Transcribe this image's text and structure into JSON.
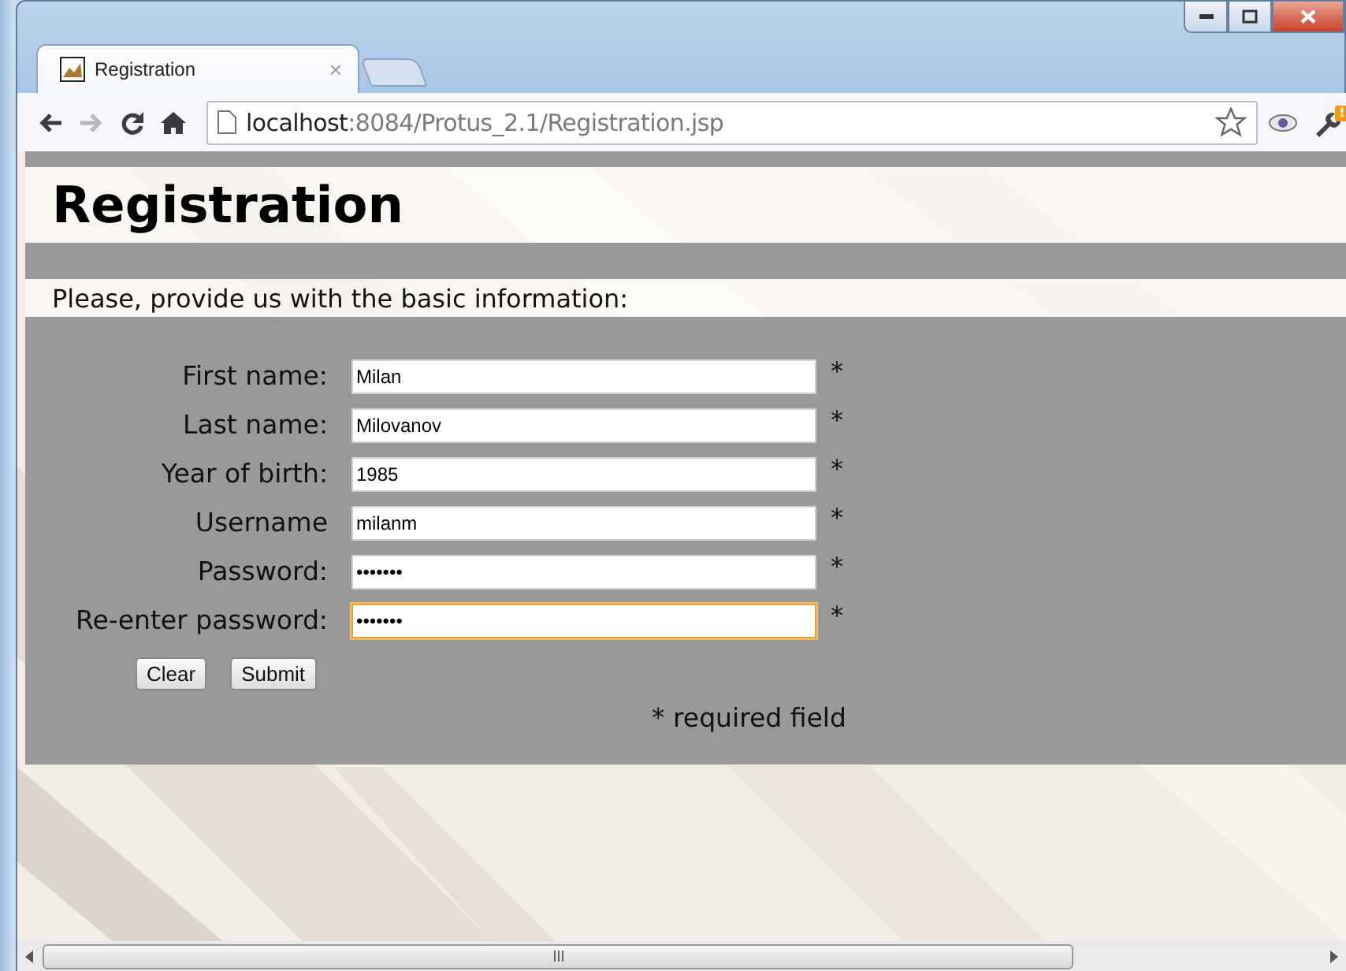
{
  "tabs": [
    {
      "title": "Registration",
      "close": "×",
      "selected": true
    }
  ],
  "nav_buttons": [
    {
      "kind": "back",
      "disabled": false
    },
    {
      "kind": "forward",
      "disabled": true
    },
    {
      "kind": "reload",
      "disabled": false
    },
    {
      "kind": "home",
      "disabled": false
    }
  ],
  "address": {
    "host": "localhost",
    "path": ":8084/Protus_2.1/Registration.jsp"
  },
  "menu_badge": "!",
  "page": {
    "title": "Registration",
    "intro": "Please, provide us with the basic information:",
    "fields": [
      {
        "label": "First name:",
        "value": "Milan",
        "marker": "*",
        "focused": false
      },
      {
        "label": "Last name:",
        "value": "Milovanov",
        "marker": "*",
        "focused": false
      },
      {
        "label": "Year of birth:",
        "value": "1985",
        "marker": "*",
        "focused": false
      },
      {
        "label": "Username",
        "value": "milanm",
        "marker": "*",
        "focused": false
      },
      {
        "label": "Password:",
        "value": "•••••••",
        "marker": "*",
        "focused": false
      },
      {
        "label": "Re-enter password:",
        "value": "•••••••",
        "marker": "*",
        "focused": true
      }
    ],
    "buttons": [
      "Clear",
      "Submit"
    ],
    "note": "* required field"
  }
}
